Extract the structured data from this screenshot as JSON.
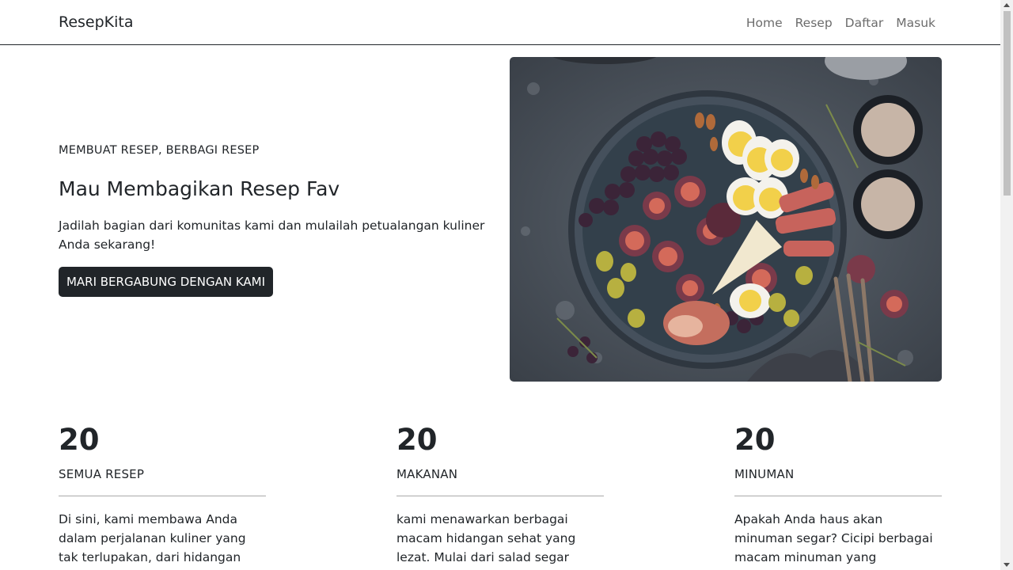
{
  "navbar": {
    "brand": "ResepKita",
    "links": [
      "Home",
      "Resep",
      "Daftar",
      "Masuk"
    ]
  },
  "hero": {
    "kicker": "MEMBUAT RESEP, BERBAGI RESEP",
    "title": "Mau Membagikan Resep Fav",
    "text": "Jadilah bagian dari komunitas kami dan mulailah petualangan kuliner Anda sekarang!",
    "button": "MARI BERGABUNG DENGAN KAMI"
  },
  "stats": [
    {
      "number": "20",
      "label": "SEMUA RESEP",
      "text": "Di sini, kami membawa Anda dalam perjalanan kuliner yang tak terlupakan, dari hidangan klasik"
    },
    {
      "number": "20",
      "label": "MAKANAN",
      "text": "kami menawarkan berbagai macam hidangan sehat yang lezat. Mulai dari salad segar hingga hidangan"
    },
    {
      "number": "20",
      "label": "MINUMAN",
      "text": "Apakah Anda haus akan minuman segar? Cicipi berbagai macam minuman yang menyegarkan, mulai"
    }
  ],
  "colors": {
    "dark": "#212529",
    "nav_link": "#6c6c6c"
  }
}
